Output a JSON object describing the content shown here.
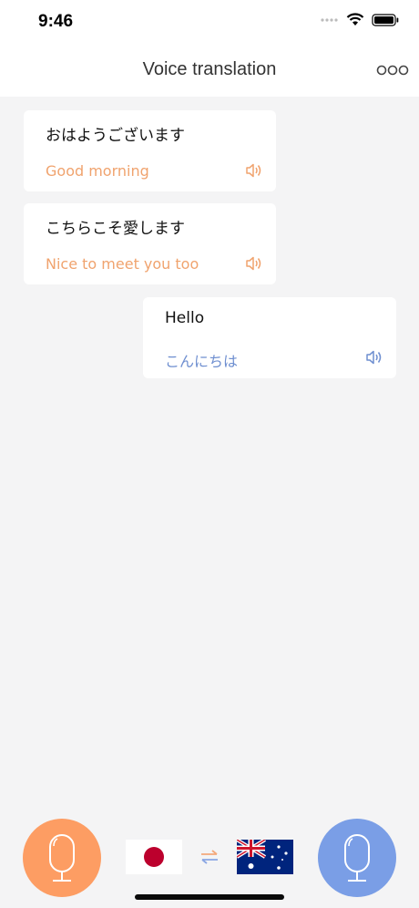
{
  "status": {
    "time": "9:46"
  },
  "nav": {
    "title": "Voice translation"
  },
  "messages": [
    {
      "source": "おはようございます",
      "translation": "Good morning"
    },
    {
      "source": "こちらこそ愛します",
      "translation": "Nice to meet you too"
    },
    {
      "source": "Hello",
      "translation": "こんにちは"
    }
  ],
  "languages": {
    "left": "japan-flag",
    "right": "australia-flag"
  },
  "colors": {
    "orange": "#fd9d63",
    "blue": "#7a9ee6",
    "orange_text": "#f0a36e",
    "blue_text": "#6f8fd0"
  }
}
